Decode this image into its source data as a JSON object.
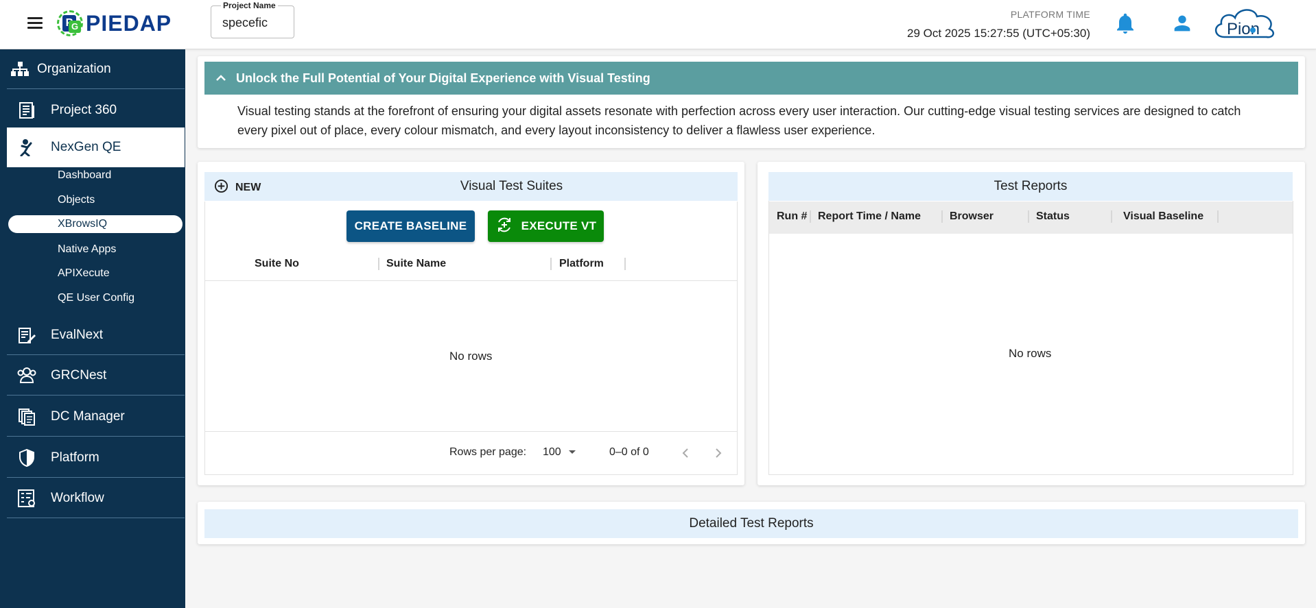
{
  "header": {
    "logo_text": "PIEDAP",
    "project_label": "Project Name",
    "project_value": "specefic",
    "platform_time_label": "PLATFORM TIME",
    "platform_time_value": "29 Oct 2025 15:27:55 (UTC+05:30)",
    "brand_logo_text": "Pion"
  },
  "sidebar": {
    "items": [
      {
        "label": "Organization"
      },
      {
        "label": "Project 360"
      },
      {
        "label": "NexGen QE"
      },
      {
        "label": "EvalNext"
      },
      {
        "label": "GRCNest"
      },
      {
        "label": "DC Manager"
      },
      {
        "label": "Platform"
      },
      {
        "label": "Workflow"
      }
    ],
    "sub_items": [
      {
        "label": "Dashboard"
      },
      {
        "label": "Objects"
      },
      {
        "label": "XBrowsIQ"
      },
      {
        "label": "Native Apps"
      },
      {
        "label": "APIXecute"
      },
      {
        "label": "QE User Config"
      }
    ]
  },
  "banner": {
    "title": "Unlock the Full Potential of Your Digital Experience with Visual Testing",
    "body": "Visual testing stands at the forefront of ensuring your digital assets resonate with perfection across every user interaction. Our cutting-edge visual testing services are designed to catch every pixel out of place, every colour mismatch, and every layout inconsistency to deliver a flawless user experience."
  },
  "suites": {
    "new_label": "NEW",
    "title": "Visual Test Suites",
    "create_baseline": "CREATE BASELINE",
    "execute_vt": "EXECUTE VT",
    "columns": [
      "Suite No",
      "Suite Name",
      "Platform"
    ],
    "empty_text": "No rows",
    "rows_per_page_label": "Rows per page:",
    "rows_per_page_value": "100",
    "range": "0–0 of 0"
  },
  "reports": {
    "title": "Test Reports",
    "columns": [
      "Run #",
      "Report Time / Name",
      "Browser",
      "Status",
      "Visual Baseline"
    ],
    "empty_text": "No rows"
  },
  "detailed": {
    "title": "Detailed Test Reports"
  },
  "colors": {
    "sidebar_bg": "#0d324f",
    "banner_bg": "#5b9ea0",
    "panel_header_bg": "#e3f0fb",
    "primary_button": "#0c5585",
    "success_button": "#0a8a0a",
    "icon_blue": "#1f8fd8"
  }
}
